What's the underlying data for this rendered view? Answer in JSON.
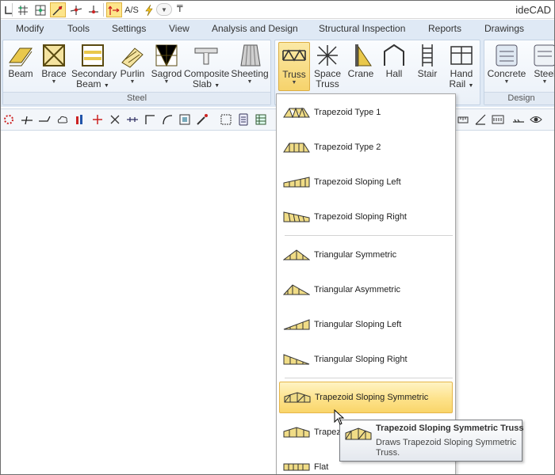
{
  "app": {
    "title": "ideCAD"
  },
  "menu_tabs": [
    "Modify",
    "Tools",
    "Settings",
    "View",
    "Analysis and Design",
    "Structural Inspection",
    "Reports",
    "Drawings"
  ],
  "ribbon": {
    "steel_group": {
      "label": "Steel",
      "buttons": [
        {
          "line1": "Beam",
          "line2": ""
        },
        {
          "line1": "Brace",
          "line2": ""
        },
        {
          "line1": "Secondary",
          "line2": "Beam"
        },
        {
          "line1": "Purlin",
          "line2": ""
        },
        {
          "line1": "Sagrod",
          "line2": ""
        },
        {
          "line1": "Composite",
          "line2": "Slab"
        },
        {
          "line1": "Sheeting",
          "line2": ""
        }
      ]
    },
    "structure_group": {
      "buttons": [
        {
          "line1": "Truss",
          "line2": ""
        },
        {
          "line1": "Space",
          "line2": "Truss"
        },
        {
          "line1": "Crane",
          "line2": ""
        },
        {
          "line1": "Hall",
          "line2": ""
        },
        {
          "line1": "Stair",
          "line2": ""
        },
        {
          "line1": "Hand",
          "line2": "Rail"
        }
      ]
    },
    "design_group": {
      "label": "Design",
      "buttons": [
        {
          "line1": "Concrete",
          "line2": ""
        },
        {
          "line1": "Steel",
          "line2": ""
        }
      ]
    }
  },
  "truss_menu": {
    "items": [
      "Trapezoid Type 1",
      "Trapezoid Type 2",
      "Trapezoid Sloping Left",
      "Trapezoid Sloping Right",
      "Triangular Symmetric",
      "Triangular Asymmetric",
      "Triangular Sloping Left",
      "Triangular Sloping Right",
      "Trapezoid Sloping Symmetric",
      "Trapezo",
      "Flat"
    ],
    "highlighted": "Trapezoid Sloping Symmetric"
  },
  "tooltip": {
    "title": "Trapezoid Sloping Symmetric Truss",
    "description": "Draws Trapezoid Sloping Symmetric Truss."
  },
  "colors": {
    "highlight": "#fde28a",
    "ribbon_bg": "#dfe9f5",
    "icon_fill": "#e8c64a"
  }
}
